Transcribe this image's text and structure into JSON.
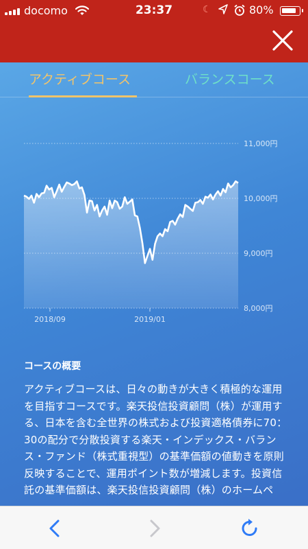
{
  "status_bar": {
    "carrier": "docomo",
    "time": "23:37",
    "battery": "80%"
  },
  "header": {
    "close_icon": "close-icon"
  },
  "tabs": [
    {
      "label": "アクティブコース",
      "active": true
    },
    {
      "label": "バランスコース",
      "active": false
    }
  ],
  "chart_data": {
    "type": "area",
    "title": "",
    "xlabel": "",
    "ylabel": "",
    "x_tick_labels": [
      "2018/09",
      "2019/01"
    ],
    "y_tick_labels": [
      "11,000円",
      "10,000円",
      "9,000円",
      "8,000円"
    ],
    "ylim": [
      8000,
      11000
    ],
    "grid": true,
    "series": [
      {
        "values": [
          10050,
          10030,
          9990,
          10050,
          9920,
          10080,
          10020,
          10090,
          10100,
          10230,
          10160,
          10190,
          10020,
          10130,
          10250,
          10120,
          10210,
          10290,
          10270,
          10240,
          10260,
          10310,
          10180,
          10200,
          10060,
          9740,
          9960,
          9950,
          9780,
          9880,
          9670,
          9780,
          9850,
          9700,
          9960,
          9820,
          9960,
          9930,
          9810,
          9850,
          10020,
          9900,
          9940,
          9980,
          9690,
          9670,
          9460,
          9180,
          8820,
          8950,
          9080,
          8880,
          9170,
          9310,
          9360,
          9310,
          9440,
          9400,
          9570,
          9590,
          9520,
          9630,
          9710,
          9660,
          9880,
          9850,
          9810,
          9770,
          9920,
          9930,
          9970,
          9900,
          10030,
          10010,
          10070,
          9980,
          10070,
          10130,
          10050,
          10170,
          10110,
          10270,
          10200,
          10240,
          10310,
          10280
        ]
      }
    ],
    "colors": {
      "line": "#ffffff",
      "fill": "#9cc6f0"
    }
  },
  "overview": {
    "heading": "コースの概要",
    "body": "アクティブコースは、日々の動きが大きく積極的な運用を目指すコースです。楽天投信投資顧問（株）が運用する、日本を含む全世界の株式および投資適格債券に70：30の配分で分散投資する楽天・インデックス・バランス・ファンド（株式重視型）の基準価額の値動きを原則反映することで、運用ポイント数が増減します。投資信託の基準価額は、楽天投信投資顧問（株）のホームペ"
  },
  "toolbar": {
    "back_icon": "back-icon",
    "forward_icon": "forward-icon",
    "reload_icon": "reload-icon"
  }
}
